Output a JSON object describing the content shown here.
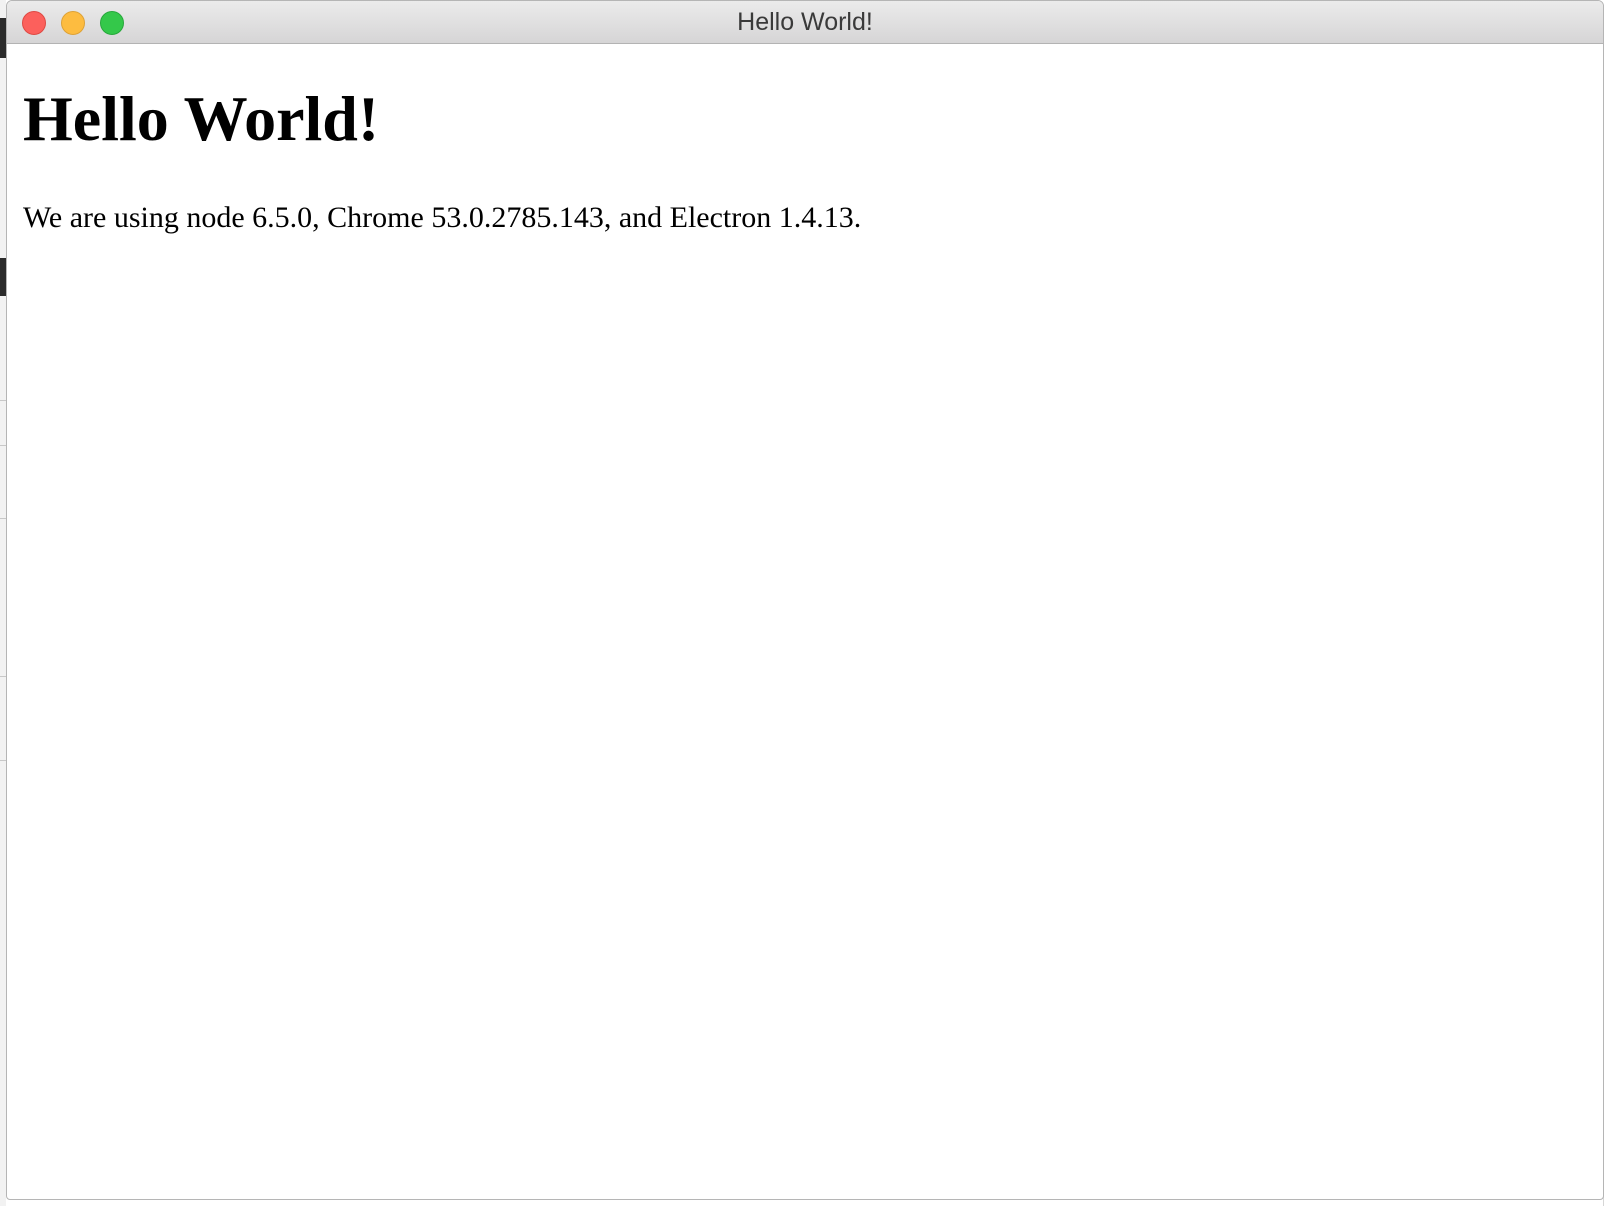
{
  "window": {
    "title": "Hello World!",
    "controls": {
      "close": "close-button",
      "minimize": "minimize-button",
      "zoom": "zoom-button"
    }
  },
  "main": {
    "heading": "Hello World!",
    "version_line": "We are using node 6.5.0, Chrome 53.0.2785.143, and Electron 1.4.13."
  },
  "colors": {
    "close": "#fc605c",
    "minimize": "#fdbc40",
    "zoom": "#34c84a",
    "titlebar": "#e3e3e3",
    "background": "#ffffff"
  }
}
